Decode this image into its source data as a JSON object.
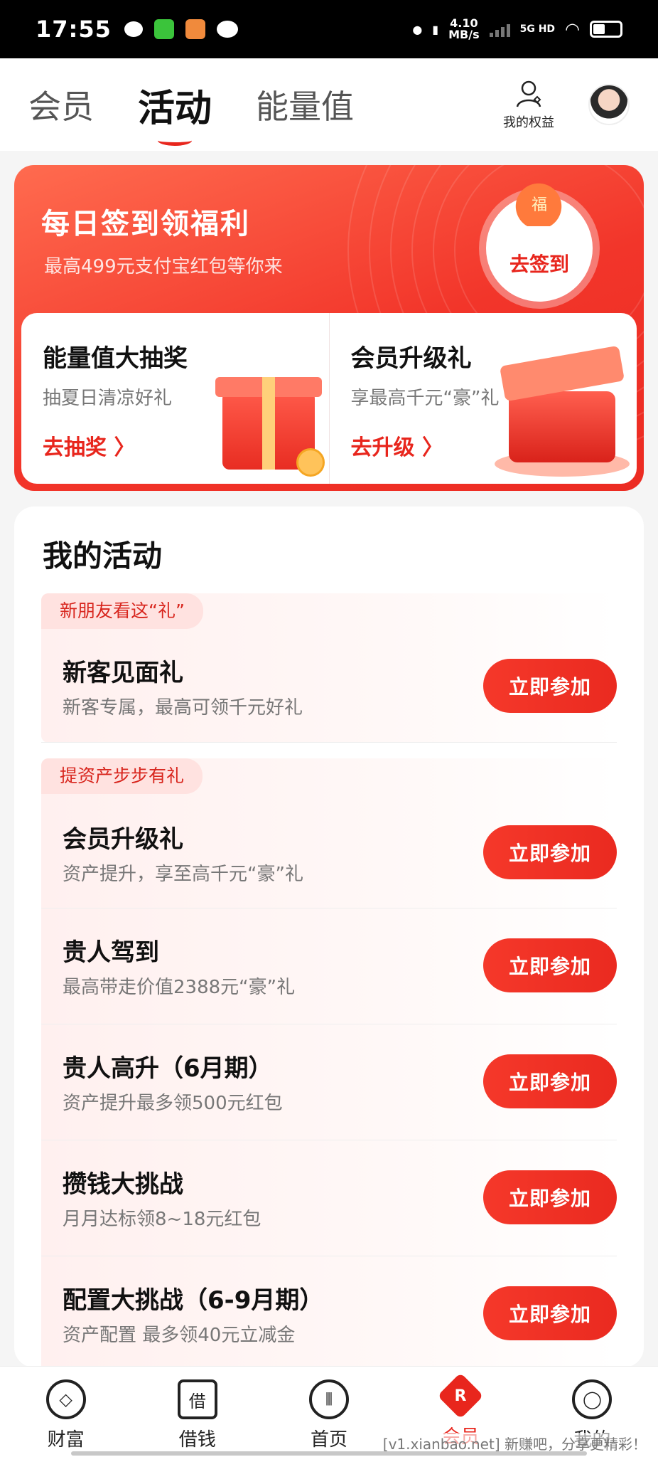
{
  "status_bar": {
    "time": "17:55",
    "net_speed_value": "4.10",
    "net_speed_unit": "MB/s",
    "network_type": "5G HD",
    "icons": [
      "chat-bubble-icon",
      "iqiyi-icon",
      "app-icon",
      "wechat-icon",
      "location-icon",
      "vibrate-icon",
      "signal-icon",
      "wifi-icon",
      "battery-icon"
    ]
  },
  "header": {
    "tabs": [
      {
        "label": "会员",
        "active": false
      },
      {
        "label": "活动",
        "active": true
      },
      {
        "label": "能量值",
        "active": false
      }
    ],
    "my_rights_label": "我的权益"
  },
  "promo": {
    "title": "每日签到领福利",
    "subtitle": "最高499元支付宝红包等你来",
    "sign_bag_char": "福",
    "sign_button": "去签到",
    "cards": [
      {
        "title": "能量值大抽奖",
        "subtitle": "抽夏日清凉好礼",
        "link": "去抽奖 〉"
      },
      {
        "title": "会员升级礼",
        "subtitle": "享最高千元“豪”礼",
        "link": "去升级 〉"
      }
    ]
  },
  "activities": {
    "title": "我的活动",
    "groups": [
      {
        "tag": "新朋友看这“礼”",
        "rows": [
          {
            "title": "新客见面礼",
            "subtitle": "新客专属，最高可领千元好礼",
            "button": "立即参加"
          }
        ]
      },
      {
        "tag": "提资产步步有礼",
        "rows": [
          {
            "title": "会员升级礼",
            "subtitle": "资产提升，享至高千元“豪”礼",
            "button": "立即参加"
          },
          {
            "title": "贵人驾到",
            "subtitle": "最高带走价值2388元“豪”礼",
            "button": "立即参加"
          },
          {
            "title": "贵人高升（6月期）",
            "subtitle": "资产提升最多领500元红包",
            "button": "立即参加"
          },
          {
            "title": "攒钱大挑战",
            "subtitle": "月月达标领8~18元红包",
            "button": "立即参加"
          },
          {
            "title": "配置大挑战（6-9月期）",
            "subtitle": "资产配置 最多领40元立减金",
            "button": "立即参加"
          }
        ]
      }
    ]
  },
  "bottom_nav": [
    {
      "label": "财富",
      "icon": "diamond-icon",
      "glyph": "◇",
      "active": false
    },
    {
      "label": "借钱",
      "icon": "borrow-icon",
      "glyph": "借",
      "active": false
    },
    {
      "label": "首页",
      "icon": "home-icon",
      "glyph": "⦀",
      "active": false
    },
    {
      "label": "会员",
      "icon": "member-icon",
      "glyph": "R",
      "active": true
    },
    {
      "label": "我的",
      "icon": "person-icon",
      "glyph": "◯",
      "active": false
    }
  ],
  "watermark": "[v1.xianbao.net] 新赚吧，分享更精彩！",
  "colors": {
    "accent": "#e8261d",
    "promo_bg": "#f2352a",
    "tag_bg": "#ffe2e0"
  }
}
